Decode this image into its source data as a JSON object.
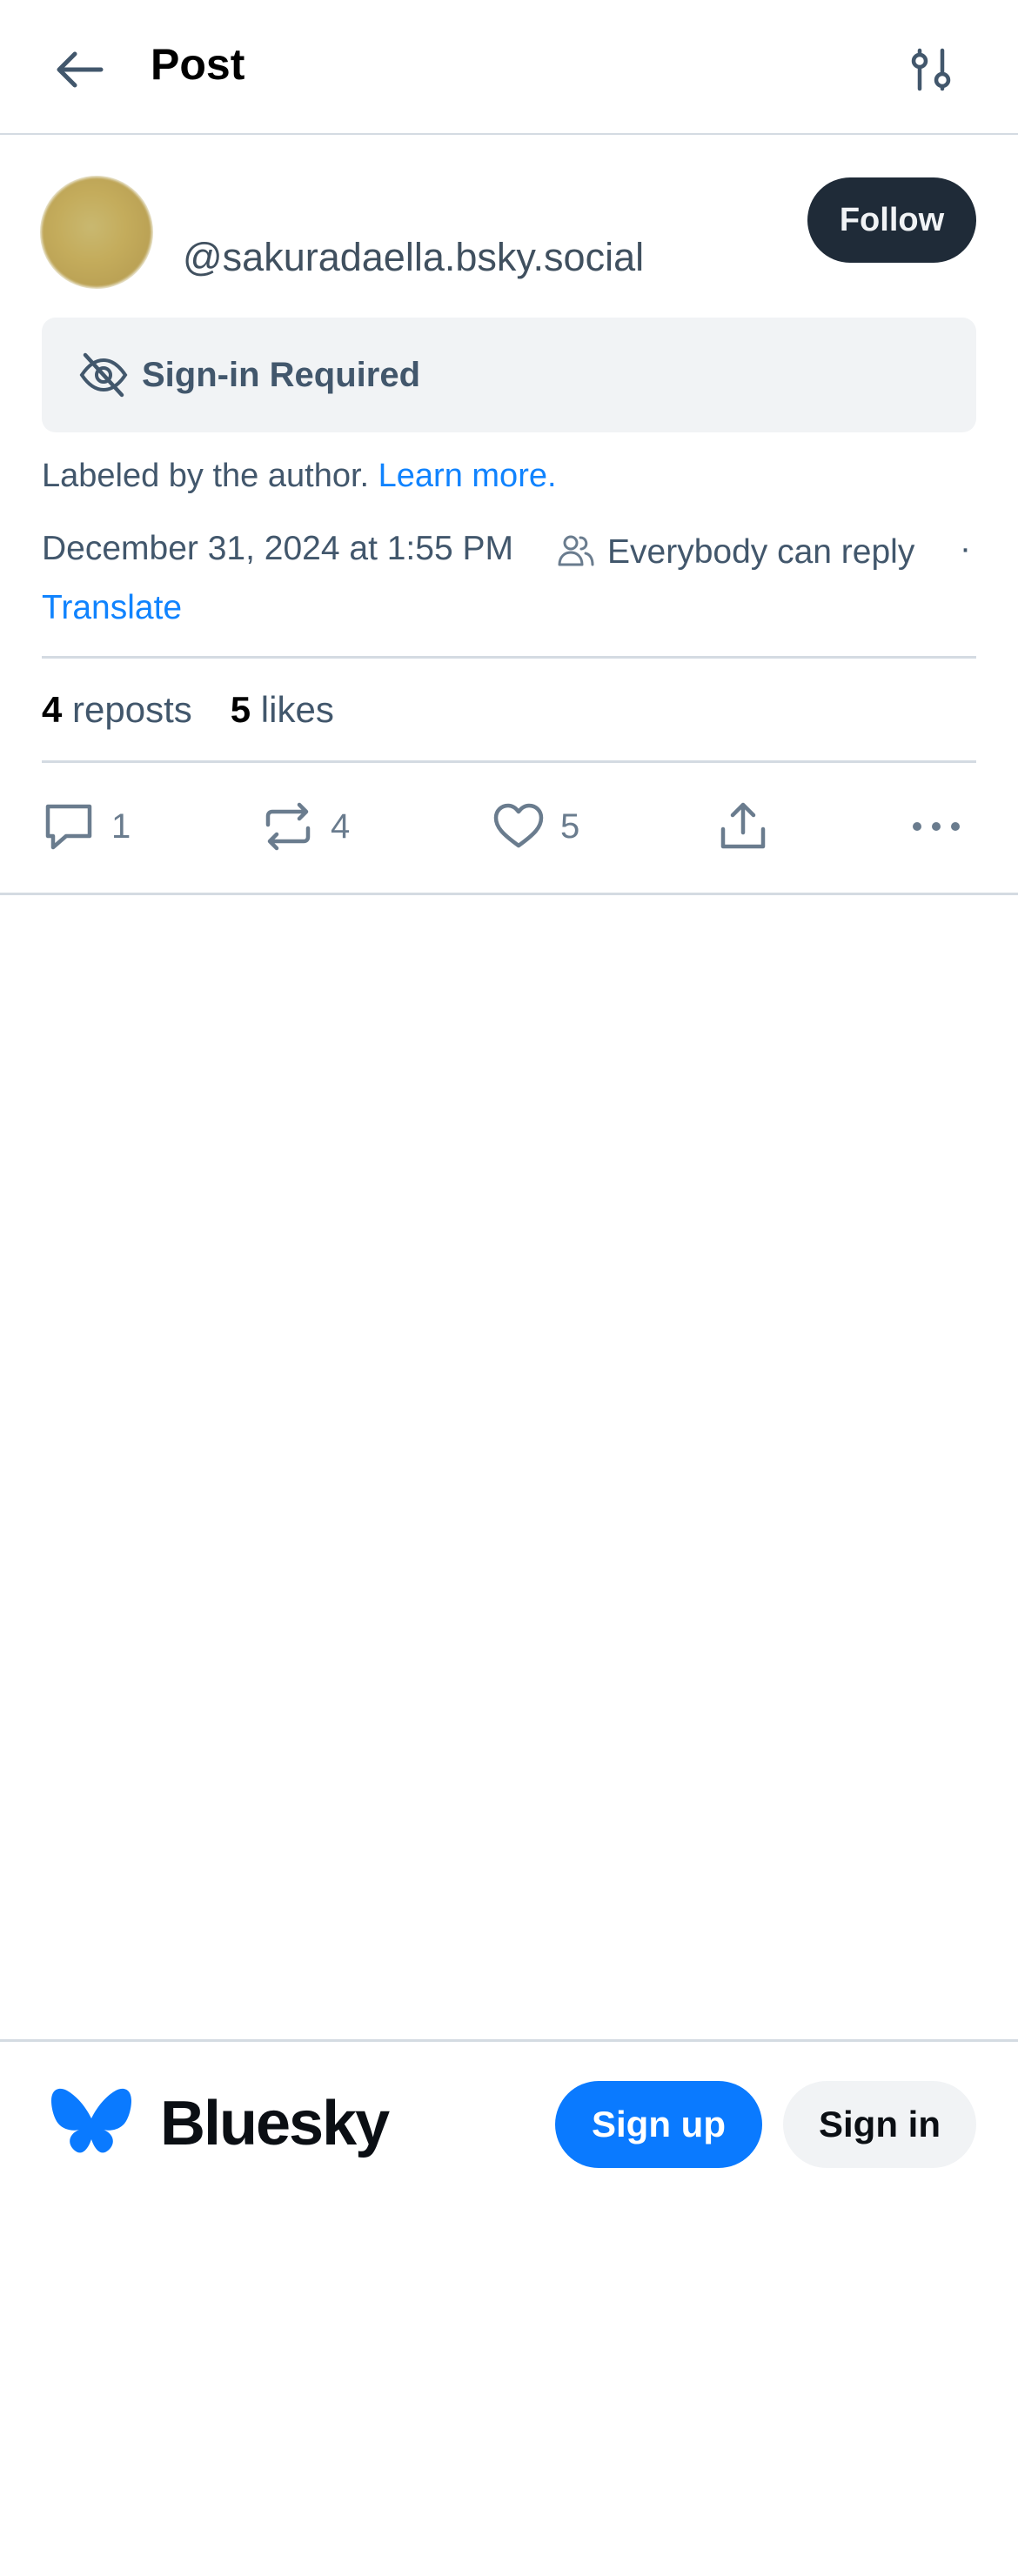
{
  "header": {
    "title": "Post",
    "back_icon": "arrow-left-icon",
    "settings_icon": "sliders-icon"
  },
  "post": {
    "handle": "@sakuradaella.bsky.social",
    "follow_label": "Follow",
    "content_notice": "Sign-in Required",
    "label_text": "Labeled by the author.",
    "learn_more": "Learn more.",
    "timestamp": "December 31, 2024 at 1:55 PM",
    "reply_setting": "Everybody can reply",
    "separator": "·",
    "translate": "Translate",
    "repost_count": "4",
    "repost_label": "reposts",
    "like_count": "5",
    "like_label": "likes"
  },
  "actions": {
    "reply_count": "1",
    "repost_count": "4",
    "like_count": "5"
  },
  "footer": {
    "brand": "Bluesky",
    "signup_label": "Sign up",
    "signin_label": "Sign in"
  },
  "colors": {
    "accent": "#1083fe",
    "primary_button": "#0a7aff",
    "follow_button": "#1f2b38",
    "muted_text": "#42576c",
    "border": "#d4dbe2",
    "notice_background": "#f1f3f5"
  }
}
